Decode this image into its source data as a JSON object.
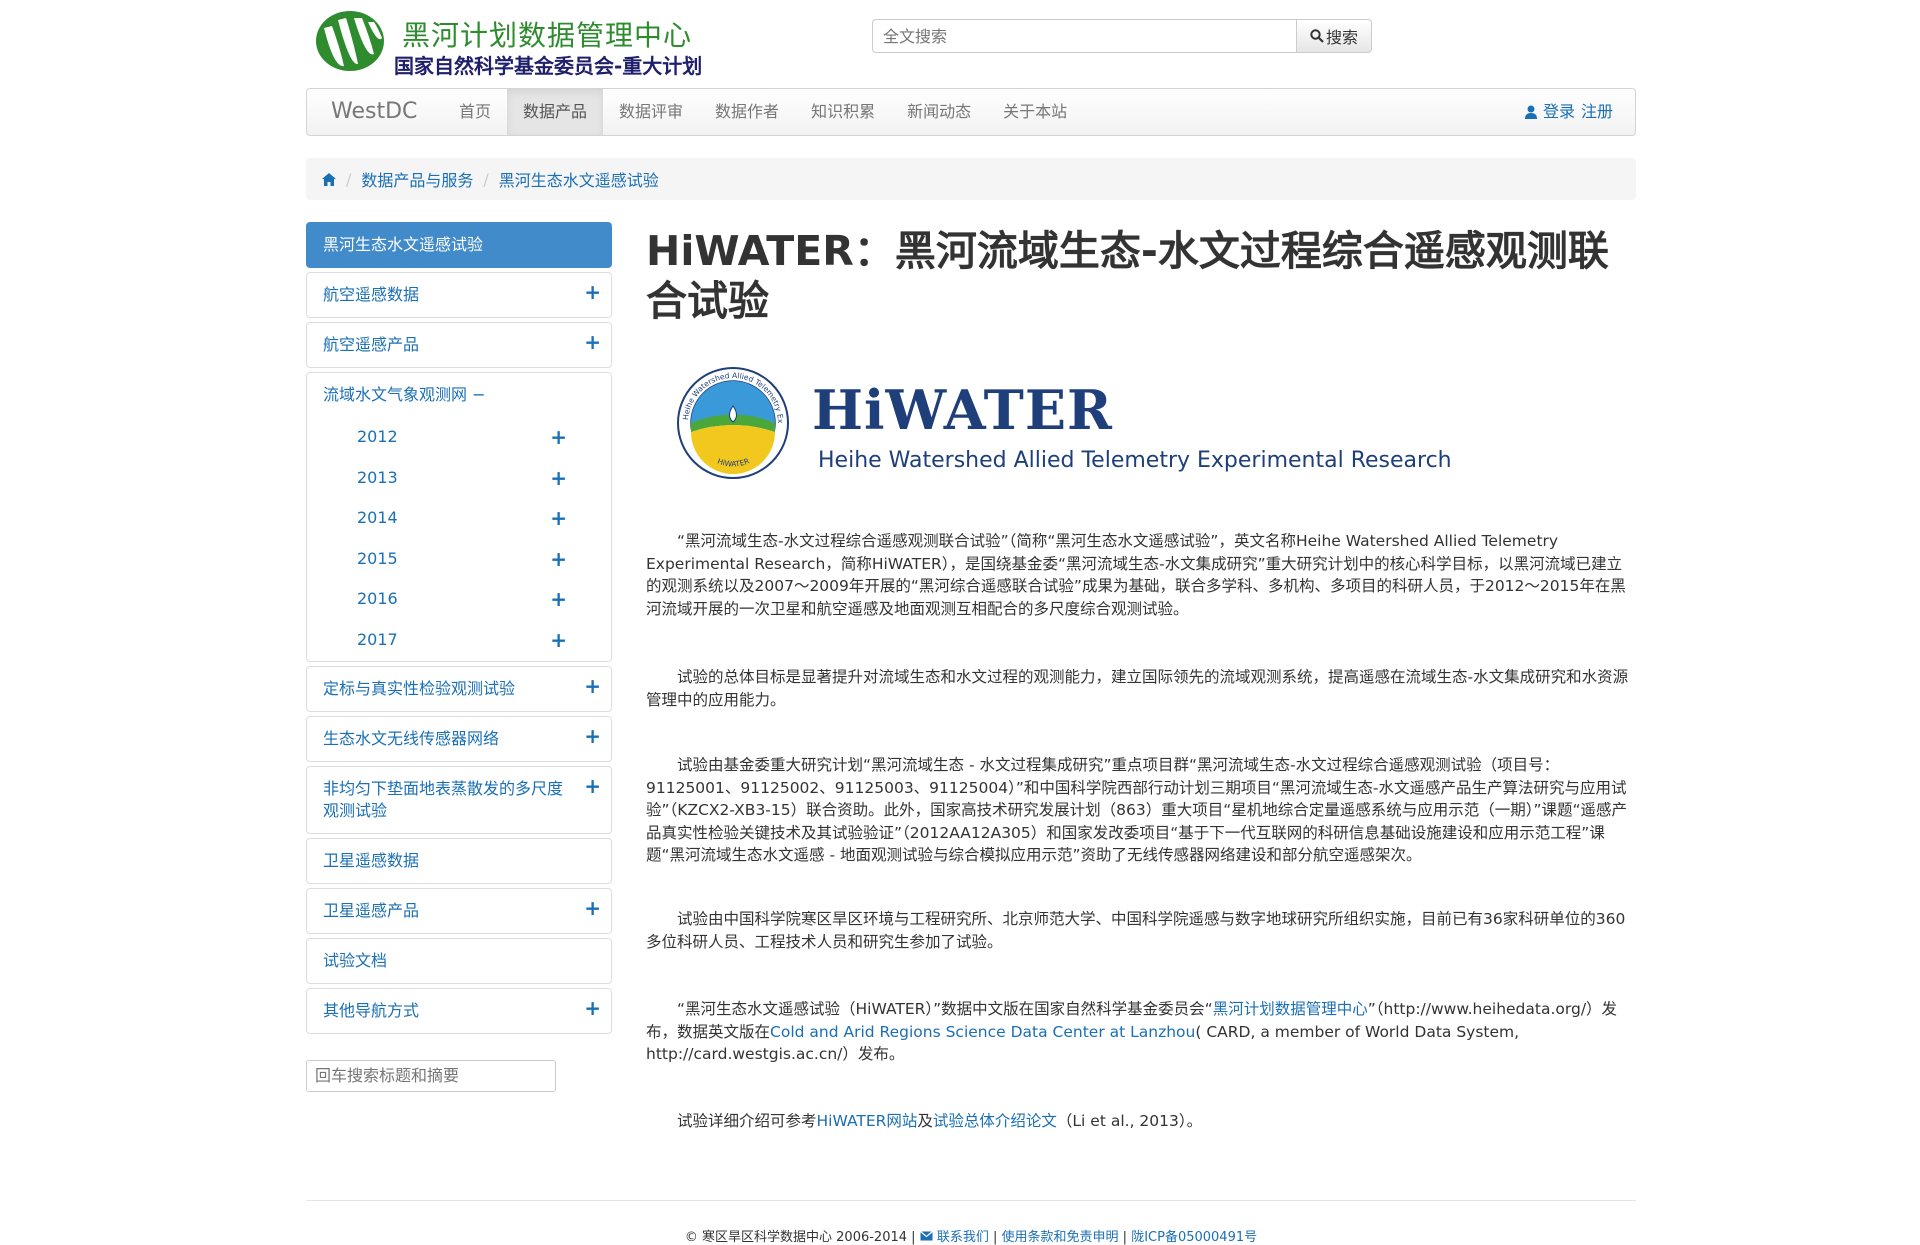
{
  "header": {
    "logo_line1": "黑河计划数据管理中心",
    "logo_line2": "国家自然科学基金委员会-重大计划",
    "search_placeholder": "全文搜索",
    "search_button": "搜索"
  },
  "navbar": {
    "brand": "WestDC",
    "items": [
      "首页",
      "数据产品",
      "数据评审",
      "数据作者",
      "知识积累",
      "新闻动态",
      "关于本站"
    ],
    "login": "登录",
    "register": "注册"
  },
  "breadcrumb": {
    "items": [
      "数据产品与服务",
      "黑河生态水文遥感试验"
    ]
  },
  "sidebar": {
    "active": "黑河生态水文遥感试验",
    "items_before": [
      "航空遥感数据",
      "航空遥感产品"
    ],
    "group": {
      "label": "流域水文气象观测网",
      "years": [
        "2012",
        "2013",
        "2014",
        "2015",
        "2016",
        "2017"
      ]
    },
    "items_after": [
      "定标与真实性检验观测试验",
      "生态水文无线传感器网络",
      "非均匀下垫面地表蒸散发的多尺度观测试验",
      "卫星遥感数据",
      "卫星遥感产品",
      "试验文档",
      "其他导航方式"
    ],
    "search_placeholder": "回车搜索标题和摘要"
  },
  "main": {
    "title": "HiWATER：黑河流域生态-水文过程综合遥感观测联合试验",
    "logo_title": "HiWATER",
    "logo_subtitle": "Heihe Watershed Allied Telemetry Experimental Research",
    "emblem_text_top": "Heihe Watershed Allied Telemetry Experimental",
    "emblem_text_bottom": "HiWATER",
    "p1": "“黑河流域生态-水文过程综合遥感观测联合试验”（简称“黑河生态水文遥感试验”，英文名称Heihe Watershed Allied Telemetry Experimental Research，简称HiWATER），是国绕基金委“黑河流域生态-水文集成研究”重大研究计划中的核心科学目标，以黑河流域已建立的观测系统以及2007～2009年开展的“黑河综合遥感联合试验”成果为基础，联合多学科、多机构、多项目的科研人员，于2012～2015年在黑河流域开展的一次卫星和航空遥感及地面观测互相配合的多尺度综合观测试验。",
    "p2": "试验的总体目标是显著提升对流域生态和水文过程的观测能力，建立国际领先的流域观测系统，提高遥感在流域生态-水文集成研究和水资源管理中的应用能力。",
    "p3": "试验由基金委重大研究计划“黑河流域生态 - 水文过程集成研究”重点项目群“黑河流域生态-水文过程综合遥感观测试验（项目号：91125001、91125002、91125003、91125004）”和中国科学院西部行动计划三期项目“黑河流域生态-水文遥感产品生产算法研究与应用试验”（KZCX2-XB3-15）联合资助。此外，国家高技术研究发展计划（863）重大项目“星机地综合定量遥感系统与应用示范（一期）”课题“遥感产品真实性检验关键技术及其试验验证”（2012AA12A305）和国家发改委项目“基于下一代互联网的科研信息基础设施建设和应用示范工程”课题“黑河流域生态水文遥感 - 地面观测试验与综合模拟应用示范”资助了无线传感器网络建设和部分航空遥感架次。",
    "p4": "试验由中国科学院寒区旱区环境与工程研究所、北京师范大学、中国科学院遥感与数字地球研究所组织实施，目前已有36家科研单位的360多位科研人员、工程技术人员和研究生参加了试验。",
    "p5_a": "“黑河生态水文遥感试验（HiWATER）”数据中文版在国家自然科学基金委员会“",
    "p5_link1": "黑河计划数据管理中心",
    "p5_b": "”（http://www.heihedata.org/）发布，数据英文版在",
    "p5_link2": "Cold and Arid Regions Science Data Center at Lanzhou",
    "p5_c": "( CARD, a member of World Data System, http://card.westgis.ac.cn/）发布。",
    "p6_a": "试验详细介绍可参考",
    "p6_link1": "HiWATER网站",
    "p6_b": "及",
    "p6_link2": "试验总体介绍论文",
    "p6_c": "（Li et al., 2013）。"
  },
  "footer": {
    "copyright": "© 寒区旱区科学数据中心 2006-2014 |",
    "contact": "联系我们",
    "sep1": "|",
    "terms": "使用条款和免责申明",
    "sep2": "|",
    "icp": "陇ICP备05000491号"
  },
  "colors": {
    "link": "#1a6fb5",
    "active_item": "#428bca",
    "logo_green": "#2e8b2e"
  }
}
